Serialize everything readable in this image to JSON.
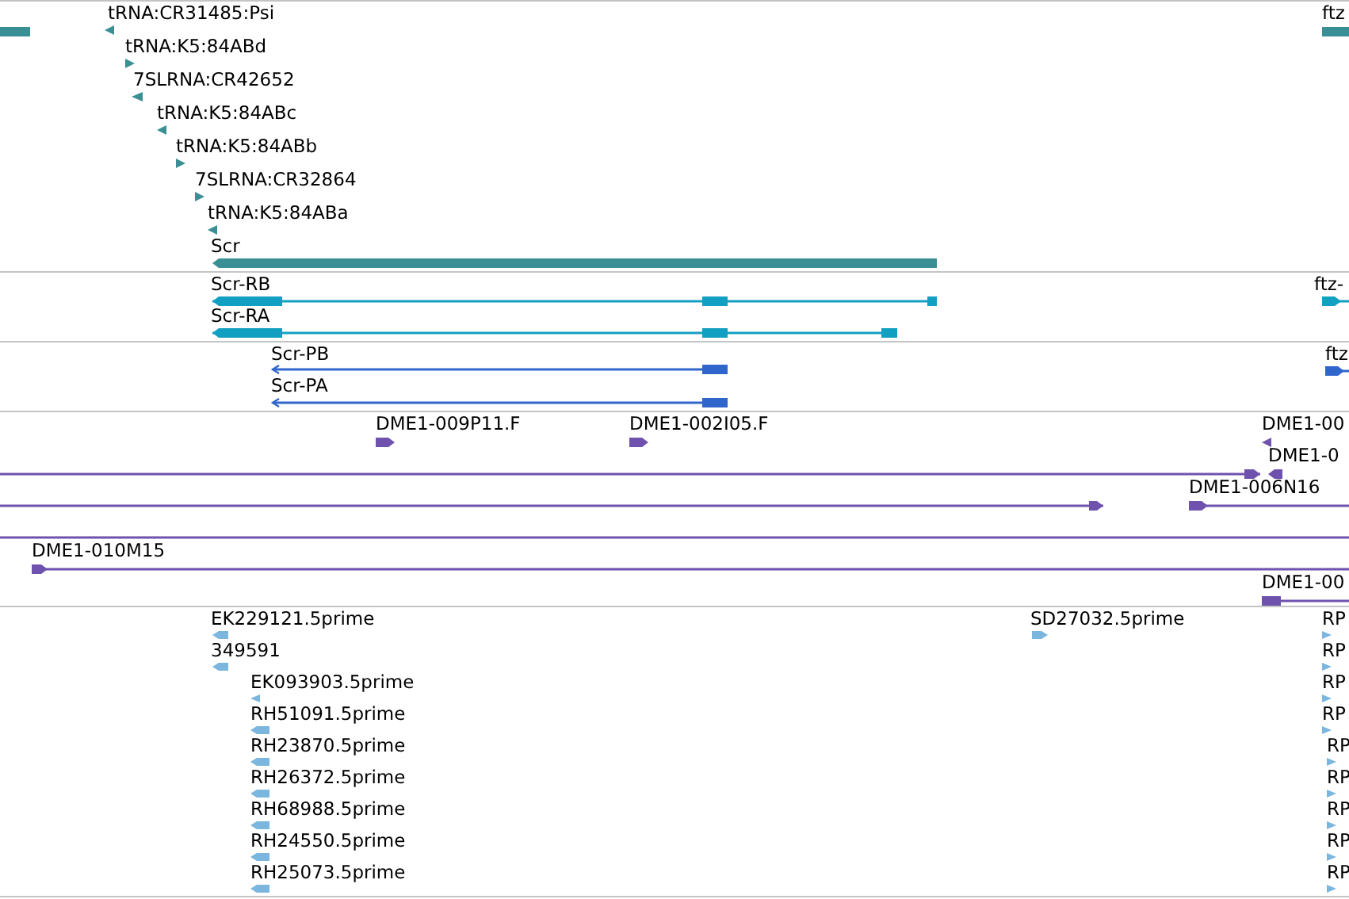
{
  "tracks": [
    {
      "kind": "gene",
      "features": [
        {
          "kind": "bar"
        },
        {
          "label": "tRNA:CR31485:Psi",
          "reverse": true
        },
        {
          "label": "tRNA:K5:84ABd",
          "reverse": false
        },
        {
          "label": "7SLRNA:CR42652",
          "reverse": true
        },
        {
          "label": "tRNA:K5:84ABc",
          "reverse": true
        },
        {
          "label": "tRNA:K5:84ABb",
          "reverse": false
        },
        {
          "label": "7SLRNA:CR32864",
          "reverse": false
        },
        {
          "label": "tRNA:K5:84ABa",
          "reverse": true
        },
        {
          "label": "Scr",
          "reverse": true
        },
        {
          "label": "ftz"
        }
      ]
    },
    {
      "kind": "transcript",
      "features": [
        {
          "label": "Scr-RB",
          "reverse": true
        },
        {
          "label": "Scr-RA",
          "reverse": true
        },
        {
          "label": "ftz-",
          "reverse": false
        }
      ]
    },
    {
      "kind": "protein",
      "features": [
        {
          "label": "Scr-PB",
          "reverse": true
        },
        {
          "label": "Scr-PA",
          "reverse": true
        },
        {
          "label": "ftz",
          "reverse": false
        }
      ]
    },
    {
      "kind": "clone",
      "features": [
        {
          "label": "DME1-009P11.F",
          "reverse": false
        },
        {
          "label": "DME1-002I05.F",
          "reverse": false
        },
        {
          "label": "DME1-00",
          "reverse": true
        },
        {
          "reverse": false
        },
        {
          "label": "DME1-0",
          "reverse": true
        },
        {
          "reverse": false
        },
        {
          "label": "DME1-006N16",
          "reverse": false
        },
        {
          "kind": "line"
        },
        {
          "label": "DME1-010M15",
          "reverse": false
        },
        {
          "label": "DME1-00",
          "reverse": false
        }
      ]
    },
    {
      "kind": "est",
      "features": [
        {
          "label": "EK229121.5prime",
          "reverse": true
        },
        {
          "label": "349591",
          "reverse": true
        },
        {
          "label": "EK093903.5prime",
          "reverse": true
        },
        {
          "label": "RH51091.5prime",
          "reverse": true
        },
        {
          "label": "RH23870.5prime",
          "reverse": true
        },
        {
          "label": "RH26372.5prime",
          "reverse": true
        },
        {
          "label": "RH68988.5prime",
          "reverse": true
        },
        {
          "label": "RH24550.5prime",
          "reverse": true
        },
        {
          "label": "RH25073.5prime",
          "reverse": true
        },
        {
          "label": "SD27032.5prime",
          "reverse": false
        },
        {
          "label": "RP",
          "reverse": false
        },
        {
          "label": "RP",
          "reverse": false
        },
        {
          "label": "RP",
          "reverse": false
        },
        {
          "label": "RP",
          "reverse": false
        },
        {
          "label": "RP",
          "reverse": false
        },
        {
          "label": "RP",
          "reverse": false
        },
        {
          "label": "RP",
          "reverse": false
        },
        {
          "label": "RP",
          "reverse": false
        },
        {
          "label": "RP",
          "reverse": false
        }
      ]
    }
  ]
}
